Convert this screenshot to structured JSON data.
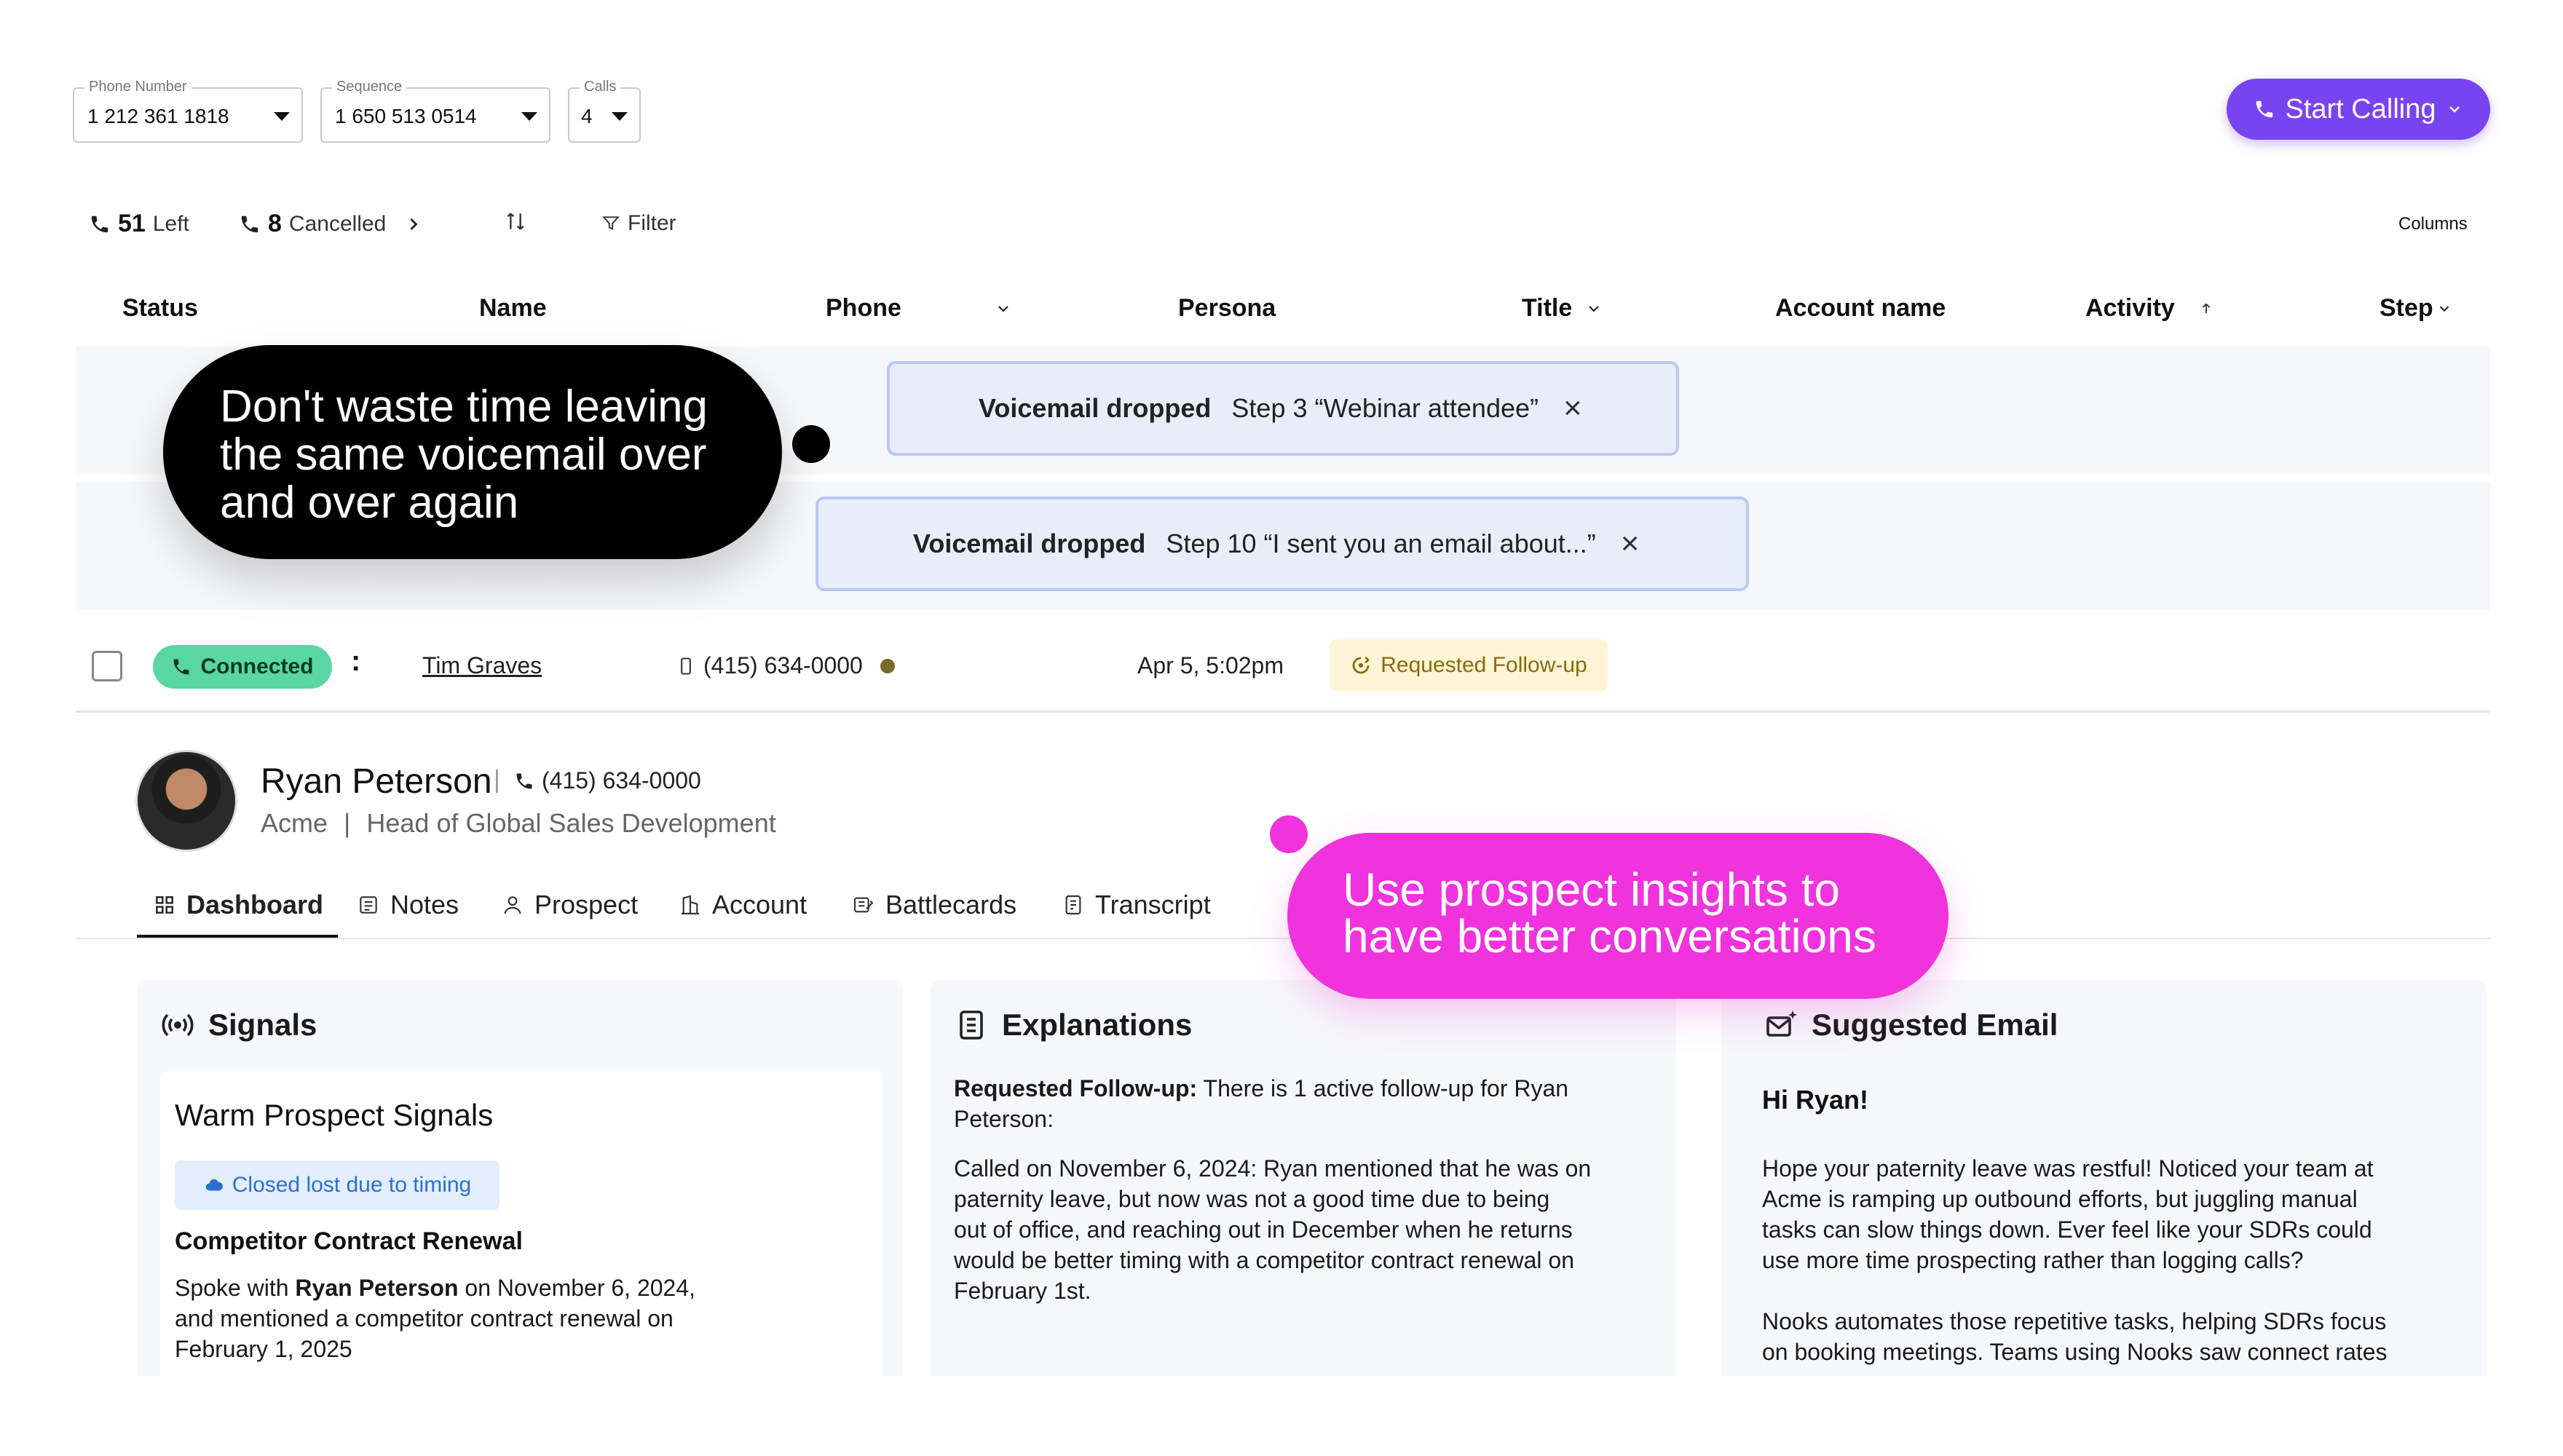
{
  "filters": {
    "phone_number": {
      "label": "Phone Number",
      "value": "1 212 361 1818"
    },
    "sequence": {
      "label": "Sequence",
      "value": "1 650 513 0514"
    },
    "calls": {
      "label": "Calls",
      "value": "4"
    }
  },
  "start_calling": {
    "label": "Start Calling"
  },
  "stats": {
    "left_count": "51",
    "left_label": "Left",
    "cancelled_count": "8",
    "cancelled_label": "Cancelled",
    "filter_label": "Filter",
    "columns_label": "Columns"
  },
  "columns": [
    "Status",
    "Name",
    "Phone",
    "Persona",
    "Title",
    "Account name",
    "Activity",
    "Step"
  ],
  "voicemails": [
    {
      "label": "Voicemail dropped",
      "step": "Step 3 “Webinar attendee”",
      "close": "×"
    },
    {
      "label": "Voicemail dropped",
      "step": "Step 10 “I sent you an email about...”",
      "close": "×"
    }
  ],
  "callouts": {
    "black_line1": "Don't waste time leaving",
    "black_line2": "the same voicemail over",
    "black_line3": "and over again",
    "pink_line1": "Use prospect insights to",
    "pink_line2": "have better conversations"
  },
  "row": {
    "status": "Connected",
    "kebab": ":",
    "name": "Tim Graves",
    "phone": "(415) 634-0000",
    "activity": "Apr 5, 5:02pm",
    "badge": "Requested Follow-up"
  },
  "prospect": {
    "name": "Ryan Peterson",
    "separator": "|",
    "phone": "(415) 634-0000",
    "company": "Acme",
    "divider": "|",
    "title": "Head of Global Sales Development"
  },
  "tabs": [
    {
      "label": "Dashboard",
      "icon": "grid-icon"
    },
    {
      "label": "Notes",
      "icon": "notes-icon"
    },
    {
      "label": "Prospect",
      "icon": "user-icon"
    },
    {
      "label": "Account",
      "icon": "building-icon"
    },
    {
      "label": "Battlecards",
      "icon": "cards-icon"
    },
    {
      "label": "Transcript",
      "icon": "transcript-icon"
    }
  ],
  "signals": {
    "title": "Signals",
    "card_title": "Warm Prospect Signals",
    "chip": "Closed lost due to timing",
    "subtitle": "Competitor Contract Renewal",
    "body_prefix": "Spoke with",
    "body_name": "Ryan Peterson",
    "body_line1_rest": "on November 6, 2024,",
    "body_line2": "and mentioned a competitor contract renewal on",
    "body_line3": "February 1, 2025"
  },
  "explanations": {
    "title": "Explanations",
    "lead_bold": "Requested Follow-up:",
    "lead_line1_rest": "There is 1 active follow-up for Ryan",
    "lead_line2": "Peterson:",
    "body_lines": [
      "Called on November 6, 2024: Ryan mentioned that he was on",
      "paternity leave, but now was not a good time due to being",
      "out of office, and reaching out in December when he returns",
      "would be better timing with a competitor contract renewal on",
      "February 1st."
    ]
  },
  "email": {
    "title": "Suggested Email",
    "greeting": "Hi Ryan!",
    "para1": [
      "Hope your paternity leave was restful! Noticed your team at",
      "Acme is ramping up outbound efforts, but juggling manual",
      "tasks can slow things down. Ever feel like your SDRs could",
      "use more time prospecting rather than logging calls?"
    ],
    "para2": [
      "Nooks automates those repetitive tasks, helping SDRs focus",
      "on booking meetings. Teams using Nooks saw connect rates"
    ]
  },
  "colors": {
    "accent_purple": "#7a43f2",
    "connected_green": "#5ad6a2",
    "callout_pink": "#f033dc",
    "voicemail_bg": "#e8edfa"
  }
}
